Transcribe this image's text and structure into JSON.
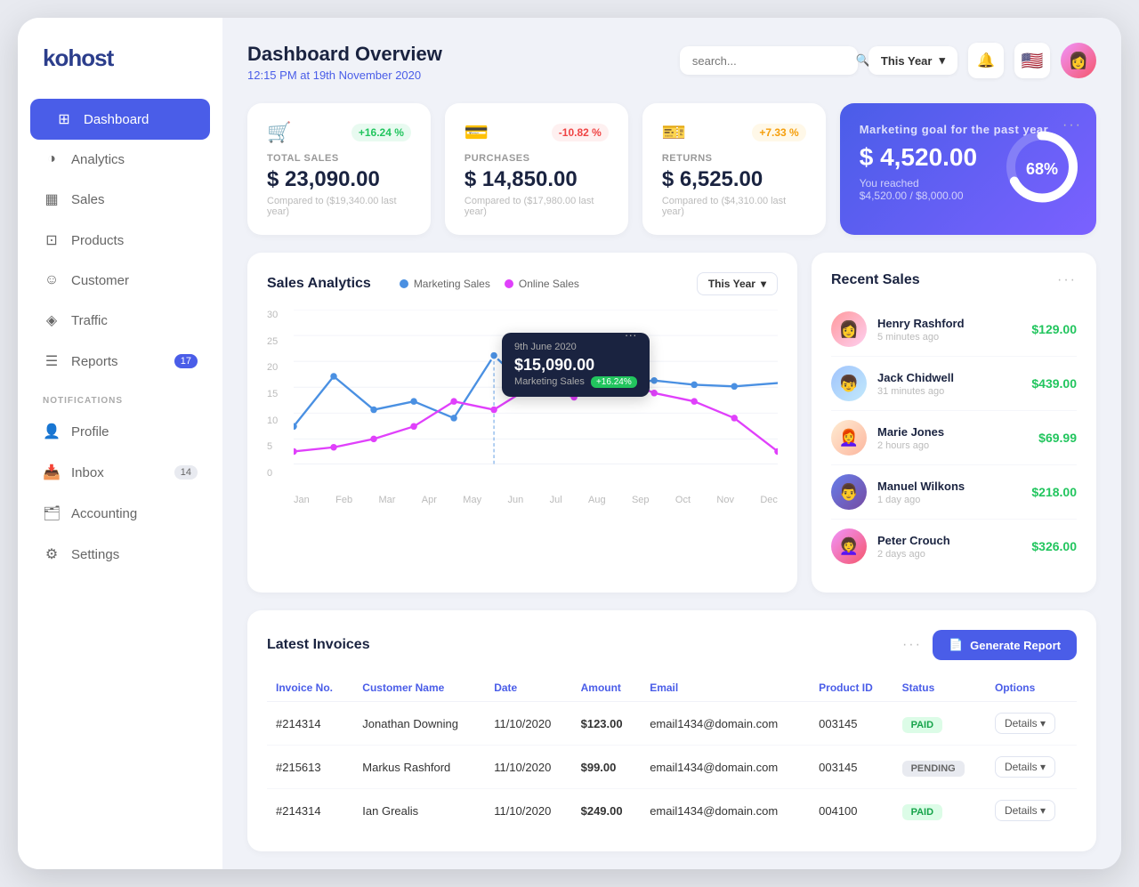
{
  "logo": {
    "text": "kohost"
  },
  "sidebar": {
    "items": [
      {
        "id": "dashboard",
        "label": "Dashboard",
        "icon": "⊞",
        "active": true
      },
      {
        "id": "analytics",
        "label": "Analytics",
        "icon": "◑"
      },
      {
        "id": "sales",
        "label": "Sales",
        "icon": "▦"
      },
      {
        "id": "products",
        "label": "Products",
        "icon": "⊡"
      },
      {
        "id": "customer",
        "label": "Customer",
        "icon": "☺"
      },
      {
        "id": "traffic",
        "label": "Traffic",
        "icon": "⊞"
      },
      {
        "id": "reports",
        "label": "Reports",
        "icon": "☰",
        "badge": "17"
      }
    ],
    "notifications_label": "NOTIFICATIONS",
    "notification_items": [
      {
        "id": "profile",
        "label": "Profile",
        "icon": "👤"
      },
      {
        "id": "inbox",
        "label": "Inbox",
        "icon": "📥",
        "badge": "14"
      },
      {
        "id": "accounting",
        "label": "Accounting",
        "icon": "🗂️"
      },
      {
        "id": "settings",
        "label": "Settings",
        "icon": "⚙"
      }
    ]
  },
  "header": {
    "title": "Dashboard Overview",
    "subtitle": "12:15 PM at 19th November 2020",
    "search_placeholder": "search...",
    "year_filter": "This Year"
  },
  "stats": [
    {
      "icon": "🛒",
      "badge_text": "+16.24 %",
      "badge_type": "green",
      "label": "TOTAL SALES",
      "value": "$ 23,090.00",
      "compare": "Compared to ($19,340.00 last year)"
    },
    {
      "icon": "💳",
      "badge_text": "-10.82 %",
      "badge_type": "red",
      "label": "PURCHASES",
      "value": "$ 14,850.00",
      "compare": "Compared to ($17,980.00 last year)"
    },
    {
      "icon": "🎫",
      "badge_text": "+7.33 %",
      "badge_type": "orange",
      "label": "RETURNS",
      "value": "$ 6,525.00",
      "compare": "Compared to ($4,310.00 last year)"
    }
  ],
  "marketing_card": {
    "label": "Marketing goal for the past year",
    "value": "$ 4,520.00",
    "reached_label": "You reached",
    "reached_value": "$4,520.00 / $8,000.00",
    "percentage": "68%",
    "percentage_num": 68
  },
  "chart": {
    "title": "Sales Analytics",
    "legend": [
      {
        "label": "Marketing Sales",
        "color": "#4a90e2"
      },
      {
        "label": "Online Sales",
        "color": "#e040fb"
      }
    ],
    "filter": "This Year",
    "y_labels": [
      "30",
      "25",
      "20",
      "15",
      "10",
      "5",
      "0"
    ],
    "months": [
      "Jan",
      "Feb",
      "Mar",
      "Apr",
      "May",
      "Jun",
      "Jul",
      "Aug",
      "Sep",
      "Oct",
      "Nov",
      "Dec"
    ],
    "tooltip": {
      "date": "9th June 2020",
      "value": "$15,090.00",
      "label": "Marketing Sales",
      "badge": "+16.24%"
    }
  },
  "recent_sales": {
    "title": "Recent Sales",
    "items": [
      {
        "name": "Henry Rashford",
        "time": "5 minutes ago",
        "amount": "$129.00"
      },
      {
        "name": "Jack Chidwell",
        "time": "31 minutes ago",
        "amount": "$439.00"
      },
      {
        "name": "Marie Jones",
        "time": "2 hours ago",
        "amount": "$69.99"
      },
      {
        "name": "Manuel Wilkons",
        "time": "1 day ago",
        "amount": "$218.00"
      },
      {
        "name": "Peter Crouch",
        "time": "2 days ago",
        "amount": "$326.00"
      }
    ]
  },
  "invoices": {
    "title": "Latest Invoices",
    "generate_btn": "Generate Report",
    "columns": [
      "Invoice No.",
      "Customer Name",
      "Date",
      "Amount",
      "Email",
      "Product ID",
      "Status",
      "Options"
    ],
    "rows": [
      {
        "invoice": "#214314",
        "name": "Jonathan Downing",
        "date": "11/10/2020",
        "amount": "$123.00",
        "email": "email1434@domain.com",
        "product_id": "003145",
        "status": "PAID"
      },
      {
        "invoice": "#215613",
        "name": "Markus Rashford",
        "date": "11/10/2020",
        "amount": "$99.00",
        "email": "email1434@domain.com",
        "product_id": "003145",
        "status": "PENDING"
      },
      {
        "invoice": "#214314",
        "name": "Ian Grealis",
        "date": "11/10/2020",
        "amount": "$249.00",
        "email": "email1434@domain.com",
        "product_id": "004100",
        "status": "PAID"
      }
    ]
  }
}
